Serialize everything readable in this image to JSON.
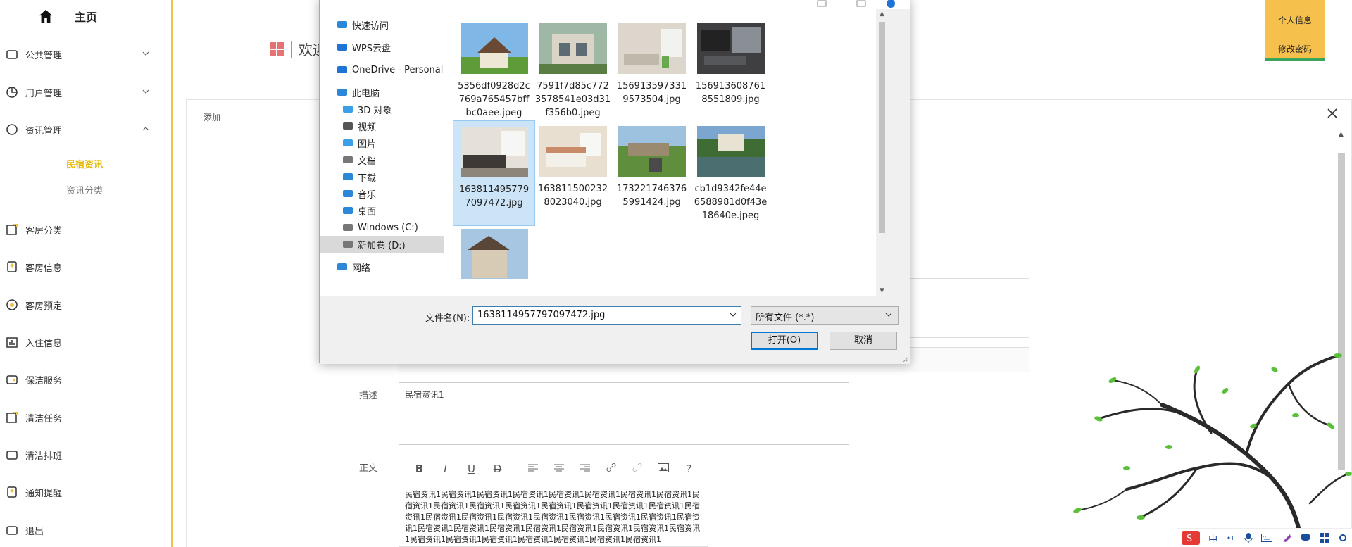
{
  "sidebar": {
    "home_label": "主页",
    "items": [
      {
        "label": "公共管理",
        "icon": "folder-icon",
        "chevron": "down"
      },
      {
        "label": "用户管理",
        "icon": "pie-chart-icon",
        "chevron": "down"
      },
      {
        "label": "资讯管理",
        "icon": "circle-icon",
        "chevron": "up"
      },
      {
        "label": "客房分类",
        "icon": "edit-icon"
      },
      {
        "label": "客房信息",
        "icon": "badge-icon"
      },
      {
        "label": "客房预定",
        "icon": "coin-icon"
      },
      {
        "label": "入住信息",
        "icon": "bar-chart-icon"
      },
      {
        "label": "保洁服务",
        "icon": "wallet-icon"
      },
      {
        "label": "清洁任务",
        "icon": "edit-icon"
      },
      {
        "label": "清洁排班",
        "icon": "folder-icon"
      },
      {
        "label": "通知提醒",
        "icon": "badge-icon"
      },
      {
        "label": "退出",
        "icon": "folder-icon"
      }
    ],
    "sub_items": [
      {
        "label": "民宿资讯",
        "active": true
      },
      {
        "label": "资讯分类",
        "active": false
      }
    ]
  },
  "header": {
    "welcome": "欢迎",
    "user_menu": [
      "个人信息",
      "修改密码"
    ]
  },
  "panel": {
    "title": "添加",
    "desc_label": "描述",
    "desc_value": "民宿资讯1",
    "body_label": "正文",
    "body_text": "民宿资讯1民宿资讯1民宿资讯1民宿资讯1民宿资讯1民宿资讯1民宿资讯1民宿资讯1民宿资讯1民宿资讯1民宿资讯1民宿资讯1民宿资讯1民宿资讯1民宿资讯1民宿资讯1民宿资讯1民宿资讯1民宿资讯1民宿资讯1民宿资讯1民宿资讯1民宿资讯1民宿资讯1民宿资讯1民宿资讯1民宿资讯1民宿资讯1民宿资讯1民宿资讯1民宿资讯1民宿资讯1民宿资讯1民宿资讯1民宿资讯1民宿资讯1民宿资讯1民宿资讯1民宿资讯1民宿资讯1",
    "toolbar": [
      "B",
      "I",
      "U",
      "D",
      "|",
      "align-left",
      "align-center",
      "align-right",
      "link",
      "unlink",
      "image",
      "?"
    ]
  },
  "dialog": {
    "nav": [
      {
        "label": "快速访问",
        "icon": "star-icon",
        "indent": 0
      },
      {
        "label": "WPS云盘",
        "icon": "cloud-icon",
        "indent": 0
      },
      {
        "label": "OneDrive - Personal",
        "icon": "cloud-icon",
        "indent": 0
      },
      {
        "label": "此电脑",
        "icon": "computer-icon",
        "indent": 0
      },
      {
        "label": "3D 对象",
        "icon": "cube-icon",
        "indent": 1
      },
      {
        "label": "视频",
        "icon": "video-icon",
        "indent": 1
      },
      {
        "label": "图片",
        "icon": "picture-icon",
        "indent": 1
      },
      {
        "label": "文档",
        "icon": "document-icon",
        "indent": 1
      },
      {
        "label": "下载",
        "icon": "download-icon",
        "indent": 1
      },
      {
        "label": "音乐",
        "icon": "music-icon",
        "indent": 1
      },
      {
        "label": "桌面",
        "icon": "desktop-icon",
        "indent": 1
      },
      {
        "label": "Windows (C:)",
        "icon": "drive-icon",
        "indent": 1
      },
      {
        "label": "新加卷 (D:)",
        "icon": "drive-icon",
        "indent": 1,
        "selected": true
      },
      {
        "label": "网络",
        "icon": "network-icon",
        "indent": 0
      }
    ],
    "files": [
      {
        "name": "5356df0928d2c769a765457bffbc0aee.jpeg",
        "lines": [
          "5356df0928d2c",
          "769a765457bff",
          "bc0aee.jpeg"
        ],
        "scene": "house"
      },
      {
        "name": "7591f7d85c7723578541e03d31f356b0.jpeg",
        "lines": [
          "7591f7d85c772",
          "3578541e03d31",
          "f356b0.jpeg"
        ],
        "scene": "villa"
      },
      {
        "name": "1569135973319573504.jpg",
        "lines": [
          "156913597331",
          "9573504.jpg"
        ],
        "scene": "living"
      },
      {
        "name": "1569136087618551809.jpg",
        "lines": [
          "156913608761",
          "8551809.jpg"
        ],
        "scene": "dark-living"
      },
      {
        "name": "1638114957797097472.jpg",
        "lines": [
          "163811495779",
          "7097472.jpg"
        ],
        "scene": "sofa",
        "selected": true
      },
      {
        "name": "1638115002328023040.jpg",
        "lines": [
          "163811500232",
          "8023040.jpg"
        ],
        "scene": "bedroom"
      },
      {
        "name": "1732217463765991424.jpg",
        "lines": [
          "173221746376",
          "5991424.jpg"
        ],
        "scene": "garden"
      },
      {
        "name": "cb1d9342fe44e6588981d0f43e18640e.jpeg",
        "lines": [
          "cb1d9342fe44e",
          "6588981d0f43e",
          "18640e.jpeg"
        ],
        "scene": "lake"
      },
      {
        "name": "",
        "lines": [],
        "scene": "roof"
      }
    ],
    "filename_label": "文件名(N):",
    "filename_value": "1638114957797097472.jpg",
    "filetype_value": "所有文件 (*.*)",
    "open_label": "打开(O)",
    "cancel_label": "取消"
  },
  "ime": {
    "label": "中"
  },
  "colors": {
    "accent": "#f0c14b",
    "active_sub": "#e8b800",
    "user_box": "#f6c04d",
    "user_box_border": "#3aa35d",
    "selected_tile": "#cce4f7",
    "primary_btn_border": "#0078d7"
  }
}
